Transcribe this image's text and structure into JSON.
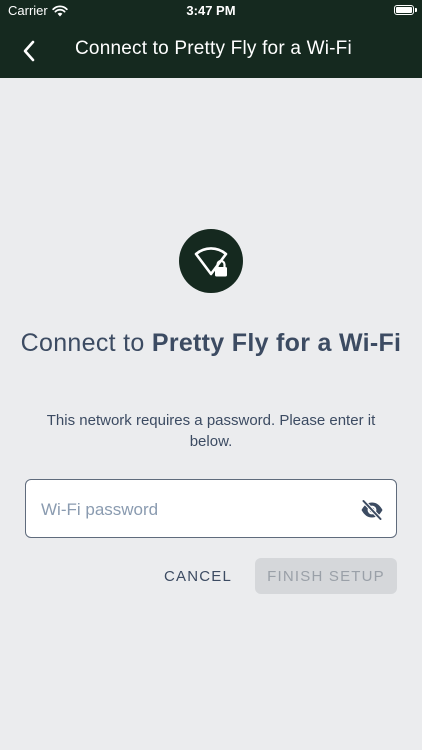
{
  "status_bar": {
    "carrier": "Carrier",
    "time": "3:47 PM",
    "wifi_icon": "wifi-icon",
    "battery_icon": "battery-icon"
  },
  "nav": {
    "back_icon": "chevron-left-icon",
    "title": "Connect to Pretty Fly for a Wi-Fi"
  },
  "hero": {
    "icon": "wifi-lock-icon",
    "heading_prefix": "Connect to ",
    "network_name": "Pretty Fly for a Wi-Fi",
    "subtext": "This network requires a password. Please enter it below."
  },
  "password": {
    "placeholder": "Wi-Fi password",
    "value": "",
    "visibility_icon": "eye-slash-icon"
  },
  "actions": {
    "cancel_label": "CANCEL",
    "finish_label": "FINISH SETUP",
    "finish_enabled": false
  },
  "colors": {
    "header_bg": "#15291f",
    "page_bg": "#ebecee",
    "text": "#3c4b62",
    "disabled_button_bg": "#d5d7da",
    "disabled_button_text": "#9aa0a8"
  }
}
